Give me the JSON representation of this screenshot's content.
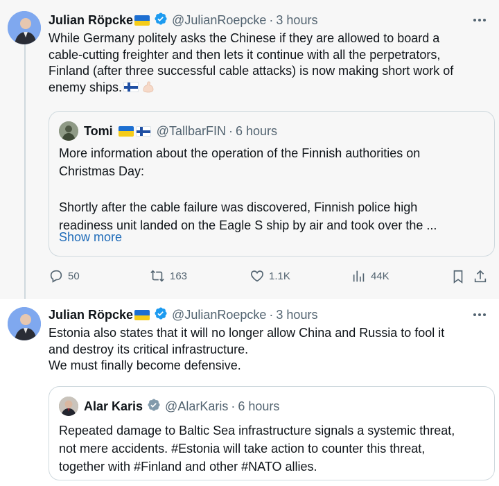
{
  "tweets": [
    {
      "author_name": "Julian Röpcke",
      "handle": "@JulianRoepcke",
      "separator": "·",
      "time": "3 hours",
      "text_lines": [
        "While Germany politely asks the Chinese if they are allowed to board a",
        "cable-cutting freighter and then lets it continue with all the perpetrators,",
        "Finland (after three successful cable attacks) is now making short work of",
        "enemy ships."
      ],
      "quote": {
        "author_name": "Tomi",
        "handle": "@TallbarFIN",
        "separator": "·",
        "time": "6 hours",
        "text_lines": [
          "More information about the operation of the Finnish authorities on",
          "Christmas Day:",
          "",
          "Shortly after the cable failure was discovered, Finnish police high",
          "readiness unit landed on the Eagle S ship by air and took over the ..."
        ],
        "show_more": "Show more"
      },
      "actions": {
        "replies": "50",
        "reposts": "163",
        "likes": "1.1K",
        "views": "44K"
      }
    },
    {
      "author_name": "Julian Röpcke",
      "handle": "@JulianRoepcke",
      "separator": "·",
      "time": "3 hours",
      "text_lines": [
        "Estonia also states that it will no longer allow China and Russia to fool it",
        "and destroy its critical infrastructure.",
        "We must finally become defensive."
      ],
      "quote": {
        "author_name": "Alar Karis",
        "handle": "@AlarKaris",
        "separator": "·",
        "time": "6 hours",
        "text_lines": [
          "Repeated damage to Baltic Sea infrastructure signals a systemic threat,",
          "not mere accidents. #Estonia will take action to counter this threat,",
          "together with #Finland and other #NATO allies."
        ]
      }
    }
  ],
  "colors": {
    "verified_blue": "#1d9bf0",
    "verified_gray": "#829aab",
    "secondary_text": "#536471",
    "link": "#1d6ab8",
    "highlight_bg": "#f7f7f7"
  }
}
